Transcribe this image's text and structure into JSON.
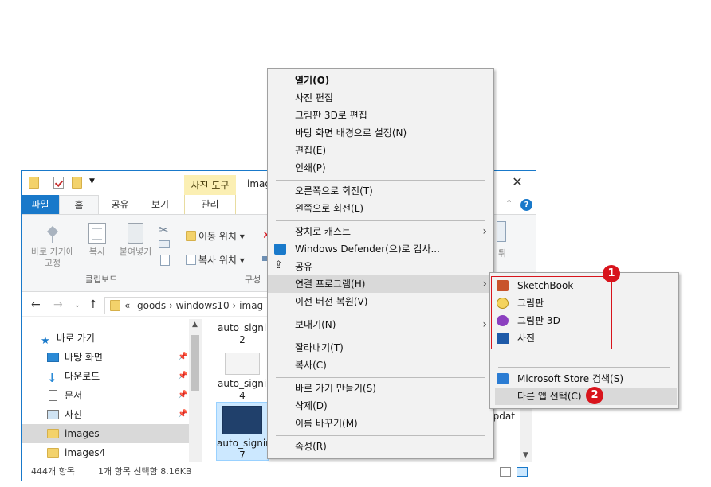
{
  "explorer": {
    "tools_tab": "사진 도구",
    "title": "imag",
    "tabs": {
      "file": "파일",
      "home": "홈",
      "share": "공유",
      "view": "보기",
      "manage": "관리"
    },
    "ribbon": {
      "pin_label_1": "바로 가기에",
      "pin_label_2": "고정",
      "copy": "복사",
      "paste": "붙여넣기",
      "move_to": "이동 위치 ▾",
      "copy_to": "복사 위치 ▾",
      "group_clipboard": "클립보드",
      "group_organize": "구성",
      "right_truncated": "뒤"
    },
    "address": {
      "chevron": "«",
      "path1": "goods",
      "sep": "›",
      "path2": "windows10",
      "path3": "imag"
    },
    "nav": [
      {
        "label": "바로 가기",
        "icon": "star-icon"
      },
      {
        "label": "바탕 화면",
        "icon": "desktop-icon"
      },
      {
        "label": "다운로드",
        "icon": "download-icon"
      },
      {
        "label": "문서",
        "icon": "document-icon"
      },
      {
        "label": "사진",
        "icon": "pictures-icon"
      },
      {
        "label": "images",
        "icon": "folder-icon"
      },
      {
        "label": "images4",
        "icon": "folder-icon"
      }
    ],
    "files": [
      {
        "l1": "auto_signin",
        "l2": "2"
      },
      {
        "l1": "auto_signin",
        "l2": "4"
      },
      {
        "l1": "auto_signin",
        "l2": "7"
      },
      {
        "l1": "updat",
        "l2": ""
      }
    ],
    "status": {
      "count": "444개 항목",
      "selected": "1개 항목 선택함 8.16KB"
    }
  },
  "menu": {
    "items": [
      {
        "label": "열기(O)",
        "bold": true
      },
      {
        "label": "사진 편집"
      },
      {
        "label": "그림판 3D로 편집"
      },
      {
        "label": "바탕 화면 배경으로 설정(N)"
      },
      {
        "label": "편집(E)"
      },
      {
        "label": "인쇄(P)"
      },
      {
        "label": "오른쪽으로 회전(T)"
      },
      {
        "label": "왼쪽으로 회전(L)"
      },
      {
        "label": "장치로 캐스트"
      },
      {
        "label": "Windows Defender(으)로 검사..."
      },
      {
        "label": "공유"
      },
      {
        "label": "연결 프로그램(H)"
      },
      {
        "label": "이전 버전 복원(V)"
      },
      {
        "label": "보내기(N)"
      },
      {
        "label": "잘라내기(T)"
      },
      {
        "label": "복사(C)"
      },
      {
        "label": "바로 가기 만들기(S)"
      },
      {
        "label": "삭제(D)"
      },
      {
        "label": "이름 바꾸기(M)"
      },
      {
        "label": "속성(R)"
      }
    ]
  },
  "submenu": {
    "apps": [
      {
        "label": "SketchBook",
        "icon": "sketchbook-icon"
      },
      {
        "label": "그림판",
        "icon": "paint-icon"
      },
      {
        "label": "그림판 3D",
        "icon": "paint3d-icon"
      },
      {
        "label": "사진",
        "icon": "photos-icon"
      }
    ],
    "store": "Microsoft Store 검색(S)",
    "other": "다른 앱 선택(C)"
  },
  "badges": {
    "one": "1",
    "two": "2"
  },
  "colors": {
    "accent": "#1979ca",
    "highlight": "#d9d9d9",
    "annotation": "#d8141c",
    "tools_tab": "#fbefb3"
  }
}
